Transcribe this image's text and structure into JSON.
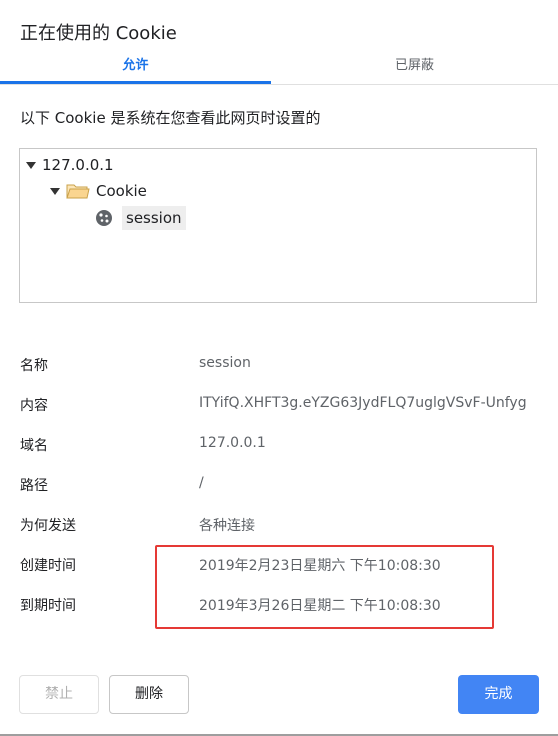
{
  "dialog": {
    "title": "正在使用的 Cookie"
  },
  "tabs": [
    {
      "label": "允许",
      "active": true
    },
    {
      "label": "已屏蔽",
      "active": false
    }
  ],
  "description": "以下 Cookie 是系统在您查看此网页时设置的",
  "tree": {
    "host": "127.0.0.1",
    "folder": "Cookie",
    "cookie": "session"
  },
  "details": [
    {
      "key": "名称",
      "value": "session"
    },
    {
      "key": "内容",
      "value": "ITYifQ.XHFT3g.eYZG63JydFLQ7uglgVSvF-Unfyg"
    },
    {
      "key": "域名",
      "value": "127.0.0.1"
    },
    {
      "key": "路径",
      "value": "/"
    },
    {
      "key": "为何发送",
      "value": "各种连接"
    },
    {
      "key": "创建时间",
      "value": "2019年2月23日星期六 下午10:08:30"
    },
    {
      "key": "到期时间",
      "value": "2019年3月26日星期二 下午10:08:30"
    }
  ],
  "buttons": {
    "block": "禁止",
    "remove": "删除",
    "done": "完成"
  },
  "colors": {
    "accent": "#1a73e8",
    "primary_button": "#4285f4",
    "highlight_box": "#e53935"
  }
}
